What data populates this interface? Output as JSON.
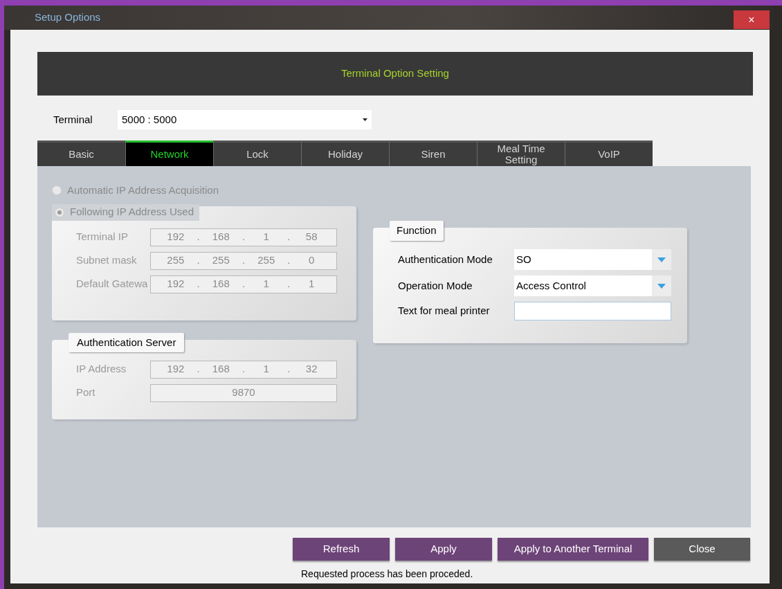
{
  "window": {
    "title": "Setup Options",
    "close": "×"
  },
  "header": {
    "title": "Terminal Option Setting"
  },
  "terminal": {
    "label": "Terminal",
    "value": "5000 : 5000"
  },
  "tabs": [
    {
      "label": "Basic",
      "selected": false
    },
    {
      "label": "Network",
      "selected": true
    },
    {
      "label": "Lock",
      "selected": false
    },
    {
      "label": "Holiday",
      "selected": false
    },
    {
      "label": "Siren",
      "selected": false
    },
    {
      "label": "Meal Time Setting",
      "selected": false
    },
    {
      "label": "VoIP",
      "selected": false
    }
  ],
  "ip_mode": [
    {
      "label": "Automatic IP Address Acquisition",
      "selected": false
    },
    {
      "label": "Following IP Address Used",
      "selected": true
    }
  ],
  "ip_fields": [
    {
      "label": "Terminal IP",
      "octets": [
        "192",
        "168",
        "1",
        "58"
      ]
    },
    {
      "label": "Subnet mask",
      "octets": [
        "255",
        "255",
        "255",
        "0"
      ]
    },
    {
      "label": "Default Gatewa",
      "octets": [
        "192",
        "168",
        "1",
        "1"
      ]
    }
  ],
  "separator": ".",
  "auth_server": {
    "title": "Authentication Server",
    "ip": {
      "label": "IP Address",
      "octets": [
        "192",
        "168",
        "1",
        "32"
      ]
    },
    "port": {
      "label": "Port",
      "value": "9870"
    }
  },
  "function": {
    "title": "Function",
    "rows": [
      {
        "kind": "dropdown",
        "label": "Authentication Mode",
        "value": "SO"
      },
      {
        "kind": "dropdown",
        "label": "Operation Mode",
        "value": "Access Control"
      },
      {
        "kind": "text",
        "label": "Text for meal printer"
      }
    ]
  },
  "buttons": [
    {
      "label": "Refresh",
      "kind": "primary"
    },
    {
      "label": "Apply",
      "kind": "primary"
    },
    {
      "label": "Apply to Another Terminal",
      "kind": "primary"
    },
    {
      "label": "Close",
      "kind": "secondary"
    }
  ],
  "status": "Requested process has been proceded."
}
